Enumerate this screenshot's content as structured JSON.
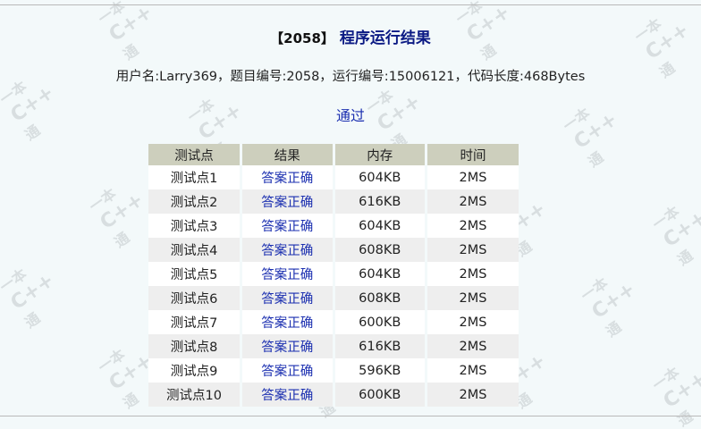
{
  "header": {
    "problem_id": "【2058】",
    "title": "程序运行结果"
  },
  "meta_line": "用户名:Larry369，题目编号:2058，运行编号:15006121，代码长度:468Bytes",
  "status": "通过",
  "table": {
    "columns": [
      "测试点",
      "结果",
      "内存",
      "时间"
    ],
    "rows": [
      {
        "point": "测试点1",
        "result": "答案正确",
        "memory": "604KB",
        "time": "2MS"
      },
      {
        "point": "测试点2",
        "result": "答案正确",
        "memory": "616KB",
        "time": "2MS"
      },
      {
        "point": "测试点3",
        "result": "答案正确",
        "memory": "604KB",
        "time": "2MS"
      },
      {
        "point": "测试点4",
        "result": "答案正确",
        "memory": "608KB",
        "time": "2MS"
      },
      {
        "point": "测试点5",
        "result": "答案正确",
        "memory": "604KB",
        "time": "2MS"
      },
      {
        "point": "测试点6",
        "result": "答案正确",
        "memory": "608KB",
        "time": "2MS"
      },
      {
        "point": "测试点7",
        "result": "答案正确",
        "memory": "600KB",
        "time": "2MS"
      },
      {
        "point": "测试点8",
        "result": "答案正确",
        "memory": "616KB",
        "time": "2MS"
      },
      {
        "point": "测试点9",
        "result": "答案正确",
        "memory": "596KB",
        "time": "2MS"
      },
      {
        "point": "测试点10",
        "result": "答案正确",
        "memory": "600KB",
        "time": "2MS"
      }
    ]
  },
  "watermark": {
    "line1": "一本",
    "line2": "C++",
    "line3": "通"
  },
  "colors": {
    "accent": "#0b1a84",
    "link": "#1b2fb0",
    "header_bg": "#cdcfbd",
    "page_bg": "#f3f9fa"
  }
}
